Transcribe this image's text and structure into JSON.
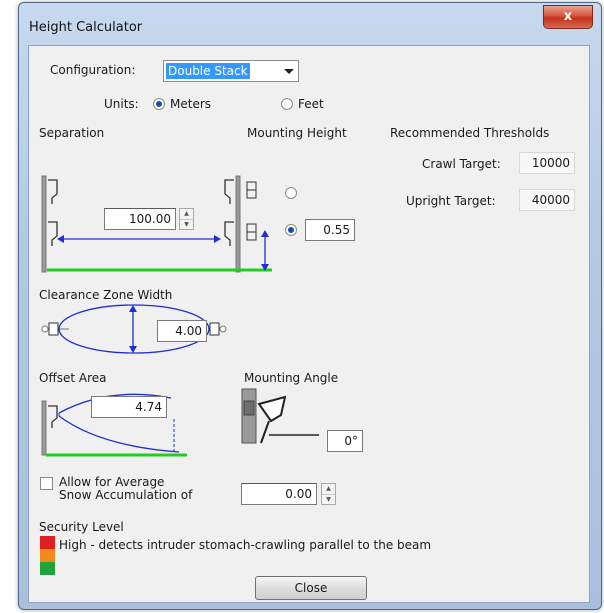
{
  "window": {
    "title": "Height Calculator",
    "close_glyph": "x"
  },
  "config": {
    "label": "Configuration:",
    "value": "Double Stack"
  },
  "units": {
    "label": "Units:",
    "options": [
      "Meters",
      "Feet"
    ],
    "selected": "Meters"
  },
  "separation": {
    "heading": "Separation",
    "value": "100.00"
  },
  "mounting_height": {
    "heading": "Mounting Height",
    "value": "0.55",
    "selected_option": 2
  },
  "thresholds": {
    "heading": "Recommended Thresholds",
    "crawl_label": "Crawl Target:",
    "crawl_value": "10000",
    "upright_label": "Upright Target:",
    "upright_value": "40000"
  },
  "clearance": {
    "heading": "Clearance Zone Width",
    "value": "4.00"
  },
  "offset": {
    "heading": "Offset Area",
    "value": "4.74"
  },
  "mounting_angle": {
    "heading": "Mounting Angle",
    "value": "0°"
  },
  "snow": {
    "line1": "Allow for Average",
    "line2": "Snow Accumulation of",
    "value": "0.00",
    "checked": false
  },
  "security": {
    "heading": "Security Level",
    "description": "High - detects intruder stomach-crawling parallel to the beam",
    "level_colors": [
      "#e02020",
      "#f08a1c",
      "#22a33a"
    ]
  },
  "close_label": "Close",
  "colors": {
    "accent_blue": "#1f2fd0",
    "ground_green": "#22cc22",
    "selection": "#3399ff"
  },
  "icons": [
    "close-icon",
    "dropdown-arrow-icon",
    "spinner-up-icon",
    "spinner-down-icon",
    "sensor-bracket-icon"
  ]
}
